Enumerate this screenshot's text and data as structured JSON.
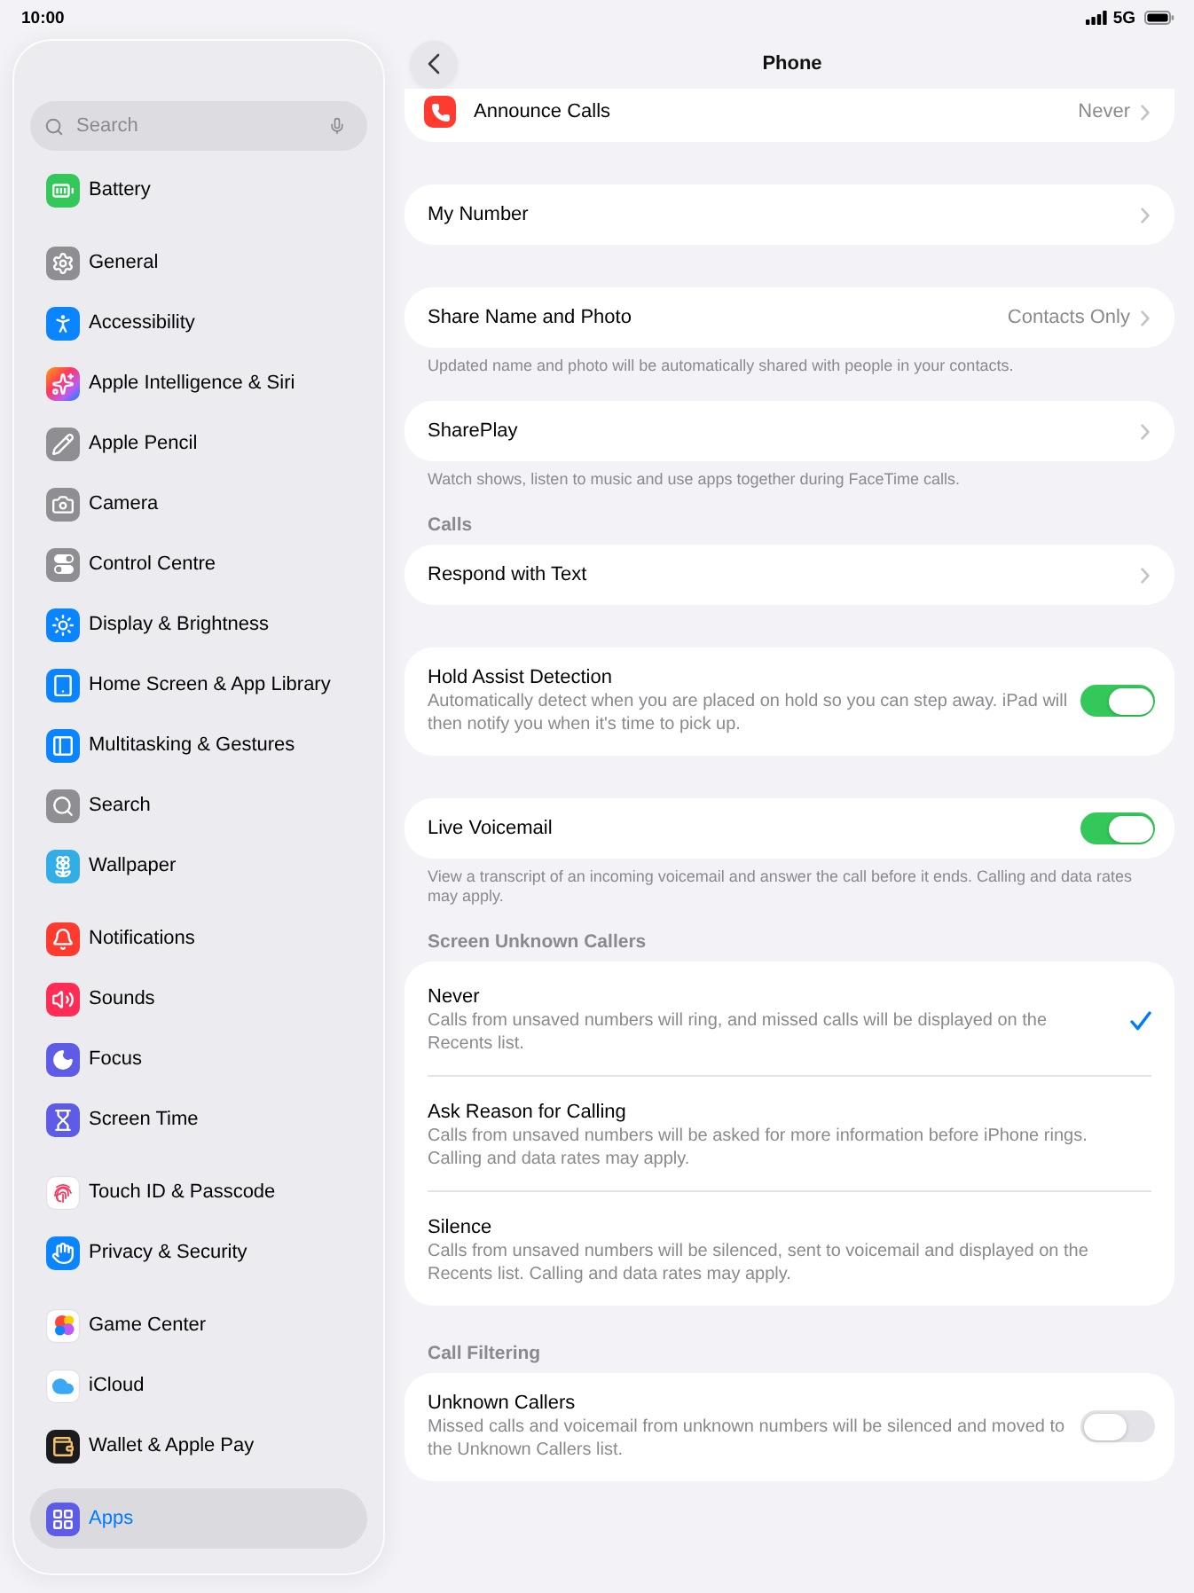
{
  "status_bar": {
    "time": "10:00",
    "network": "5G"
  },
  "sidebar": {
    "search": {
      "placeholder": "Search"
    },
    "groups": [
      {
        "items": [
          {
            "label": "Battery",
            "selected": false
          }
        ]
      },
      {
        "items": [
          {
            "label": "General",
            "selected": false
          },
          {
            "label": "Accessibility",
            "selected": false
          },
          {
            "label": "Apple Intelligence & Siri",
            "selected": false
          },
          {
            "label": "Apple Pencil",
            "selected": false
          },
          {
            "label": "Camera",
            "selected": false
          },
          {
            "label": "Control Centre",
            "selected": false
          },
          {
            "label": "Display & Brightness",
            "selected": false
          },
          {
            "label": "Home Screen & App Library",
            "selected": false
          },
          {
            "label": "Multitasking & Gestures",
            "selected": false
          },
          {
            "label": "Search",
            "selected": false
          },
          {
            "label": "Wallpaper",
            "selected": false
          }
        ]
      },
      {
        "items": [
          {
            "label": "Notifications",
            "selected": false
          },
          {
            "label": "Sounds",
            "selected": false
          },
          {
            "label": "Focus",
            "selected": false
          },
          {
            "label": "Screen Time",
            "selected": false
          }
        ]
      },
      {
        "items": [
          {
            "label": "Touch ID & Passcode",
            "selected": false
          },
          {
            "label": "Privacy & Security",
            "selected": false
          }
        ]
      },
      {
        "items": [
          {
            "label": "Game Center",
            "selected": false
          },
          {
            "label": "iCloud",
            "selected": false
          },
          {
            "label": "Wallet & Apple Pay",
            "selected": false
          }
        ]
      },
      {
        "items": [
          {
            "label": "Apps",
            "selected": true
          }
        ]
      }
    ]
  },
  "nav": {
    "title": "Phone"
  },
  "sections": [
    {
      "rows": [
        {
          "kind": "app",
          "label": "Announce Calls",
          "value": "Never"
        }
      ]
    },
    {
      "rows": [
        {
          "kind": "link",
          "label": "My Number"
        }
      ]
    },
    {
      "rows": [
        {
          "kind": "link",
          "label": "Share Name and Photo",
          "value": "Contacts Only"
        }
      ],
      "footer": "Updated name and photo will be automatically shared with people in your contacts."
    },
    {
      "rows": [
        {
          "kind": "link",
          "label": "SharePlay"
        }
      ],
      "footer": "Watch shows, listen to music and use apps together during FaceTime calls."
    },
    {
      "header": "Calls",
      "rows": [
        {
          "kind": "link",
          "label": "Respond with Text"
        }
      ]
    },
    {
      "rows": [
        {
          "kind": "toggle",
          "label": "Hold Assist Detection",
          "description": "Automatically detect when you are placed on hold so you can step away. iPad will then notify you when it's time to pick up.",
          "on": true
        }
      ]
    },
    {
      "rows": [
        {
          "kind": "toggle",
          "label": "Live Voicemail",
          "on": true
        }
      ],
      "footer": "View a transcript of an incoming voicemail and answer the call before it ends. Calling and data rates may apply."
    },
    {
      "header": "Screen Unknown Callers",
      "rows": [
        {
          "kind": "option",
          "label": "Never",
          "description": "Calls from unsaved numbers will ring, and missed calls will be displayed on the Recents list.",
          "selected": true
        },
        {
          "kind": "option",
          "label": "Ask Reason for Calling",
          "description": "Calls from unsaved numbers will be asked for more information before iPhone rings. Calling and data rates may apply.",
          "selected": false
        },
        {
          "kind": "option",
          "label": "Silence",
          "description": "Calls from unsaved numbers will be silenced, sent to voicemail and displayed on the Recents list. Calling and data rates may apply.",
          "selected": false
        }
      ]
    },
    {
      "header": "Call Filtering",
      "rows": [
        {
          "kind": "toggle",
          "label": "Unknown Callers",
          "description": "Missed calls and voicemail from unknown numbers will be silenced and moved to the Unknown Callers list.",
          "on": false
        }
      ]
    }
  ]
}
